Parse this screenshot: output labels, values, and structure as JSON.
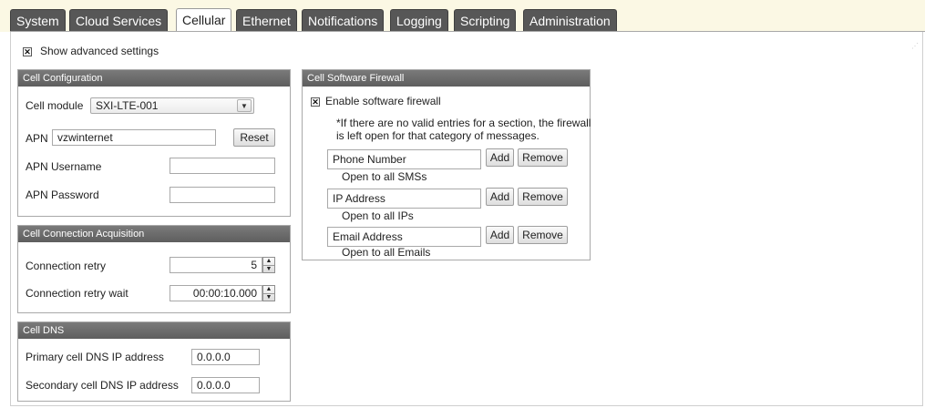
{
  "tabs": [
    {
      "label": "System"
    },
    {
      "label": "Cloud Services"
    },
    {
      "label": "Cellular"
    },
    {
      "label": "Ethernet"
    },
    {
      "label": "Notifications"
    },
    {
      "label": "Logging"
    },
    {
      "label": "Scripting"
    },
    {
      "label": "Administration"
    }
  ],
  "active_tab": "Cellular",
  "show_advanced": {
    "label": "Show advanced settings",
    "checked": true
  },
  "cell_configuration": {
    "title": "Cell Configuration",
    "cell_module_label": "Cell module",
    "cell_module_value": "SXI-LTE-001",
    "apn_label": "APN",
    "apn_value": "vzwinternet",
    "reset_label": "Reset",
    "apn_username_label": "APN Username",
    "apn_username_value": "",
    "apn_password_label": "APN Password",
    "apn_password_value": ""
  },
  "cell_connection_acquisition": {
    "title": "Cell Connection Acquisition",
    "retry_label": "Connection retry",
    "retry_value": "5",
    "retry_wait_label": "Connection retry wait",
    "retry_wait_value": "00:00:10.000"
  },
  "cell_dns": {
    "title": "Cell DNS",
    "primary_label": "Primary cell DNS IP address",
    "primary_value": "0.0.0.0",
    "secondary_label": "Secondary cell DNS IP address",
    "secondary_value": "0.0.0.0"
  },
  "firewall": {
    "title": "Cell Software Firewall",
    "enable_label": "Enable software firewall",
    "enable_checked": true,
    "note_line1": "*If there are no valid entries for a section, the firewall",
    "note_line2": "is left open for that category of messages.",
    "add_label": "Add",
    "remove_label": "Remove",
    "entries": [
      {
        "placeholder": "Phone Number",
        "status": "Open to all SMSs"
      },
      {
        "placeholder": "IP Address",
        "status": "Open to all IPs"
      },
      {
        "placeholder": "Email Address",
        "status": "Open to all Emails"
      }
    ]
  },
  "colors": {
    "tab_bg": "#575757",
    "tab_bar_bg": "#fbf8e4",
    "panel_header": "#6b6b6b"
  }
}
